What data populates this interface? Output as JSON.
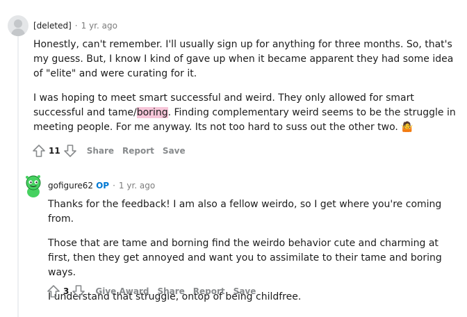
{
  "comments": [
    {
      "author": "[deleted]",
      "age": "1 yr. ago",
      "paragraphs": [
        {
          "before": "Honestly, can't remember. I'll usually sign up for anything for three months. So, that's my guess. But, I know I kind of gave up when it became apparent they had some idea of \"elite\" and were curating for it.",
          "highlight": "",
          "after": ""
        },
        {
          "before": "I was hoping to meet smart successful and weird. They only allowed for smart successful and tame/",
          "highlight": "boring",
          "after": ". Finding complementary weird seems to be the struggle in meeting people. For me anyway. Its not too hard to suss out the other two. 🤷"
        }
      ],
      "score": "11",
      "actions": [
        "Share",
        "Report",
        "Save"
      ]
    },
    {
      "author": "gofigure62",
      "op_badge": "OP",
      "age": "1 yr. ago",
      "paragraphs": [
        "Thanks for the feedback! I am also a fellow weirdo, so I get where you're coming from.",
        "Those that are tame and borning find the weirdo behavior cute and charming at first, then they get annoyed and want you to assimilate to their tame and boring ways.",
        "I understand that struggle, ontop of being childfree."
      ],
      "score": "3",
      "actions": [
        "Give Award",
        "Share",
        "Report",
        "Save"
      ]
    }
  ],
  "colors": {
    "muted": "#878a8c",
    "op_blue": "#0079d3",
    "highlight": "#f7c6d9",
    "thread_line": "#edeff1"
  },
  "icons": [
    "upvote-icon",
    "downvote-icon",
    "avatar-snoo"
  ]
}
